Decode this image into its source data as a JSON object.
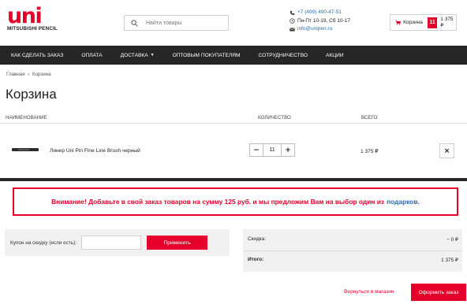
{
  "header": {
    "logo_mark": "uni",
    "logo_sub": "MITSUBISHI PENCIL",
    "search_placeholder": "Найти товары",
    "phone": "+7 (499) 490-47-51",
    "hours": "Пн-Пт 10-19, Сб 10-17",
    "email": "info@unipen.ru",
    "cart_label": "Корзина",
    "cart_count": "11",
    "cart_sum": "1 375 ₽"
  },
  "nav": {
    "items": [
      {
        "label": "КАК СДЕЛАТЬ ЗАКАЗ"
      },
      {
        "label": "ОПЛАТА"
      },
      {
        "label": "ДОСТАВКА"
      },
      {
        "label": "ОПТОВЫМ ПОКУПАТЕЛЯМ"
      },
      {
        "label": "СОТРУДНИЧЕСТВО"
      },
      {
        "label": "АКЦИИ"
      }
    ]
  },
  "breadcrumb": {
    "home": "Главная",
    "separator": "»",
    "current": "Корзина"
  },
  "page_title": "Корзина",
  "table": {
    "col_name": "НАИМЕНОВАНИЕ",
    "col_qty": "КОЛИЧЕСТВО",
    "col_total": "ВСЕГО",
    "item": {
      "name": "Линер Uni Pin Fine Line Brush черный",
      "minus": "−",
      "qty": "11",
      "plus": "+",
      "price": "1 375 ₽",
      "remove": "×"
    }
  },
  "notice": {
    "text": "Внимание! Добавьте в свой заказ товаров на сумму 125 руб. и мы предложим Вам на выбор один из",
    "link": "подарков",
    "end": "."
  },
  "coupon": {
    "label": "Купон на скидку (если есть):",
    "value": "",
    "apply_label": "Применить"
  },
  "totals": {
    "discount_label": "Скидка:",
    "discount_value": "− 0 ₽",
    "total_label": "Итого:",
    "total_value": "1 375 ₽"
  },
  "footer": {
    "back_label": "Вернуться в магазин",
    "checkout_label": "Оформить заказ"
  },
  "colors": {
    "accent": "#e4002b",
    "nav_bg": "#262626",
    "link": "#2a6db0"
  }
}
